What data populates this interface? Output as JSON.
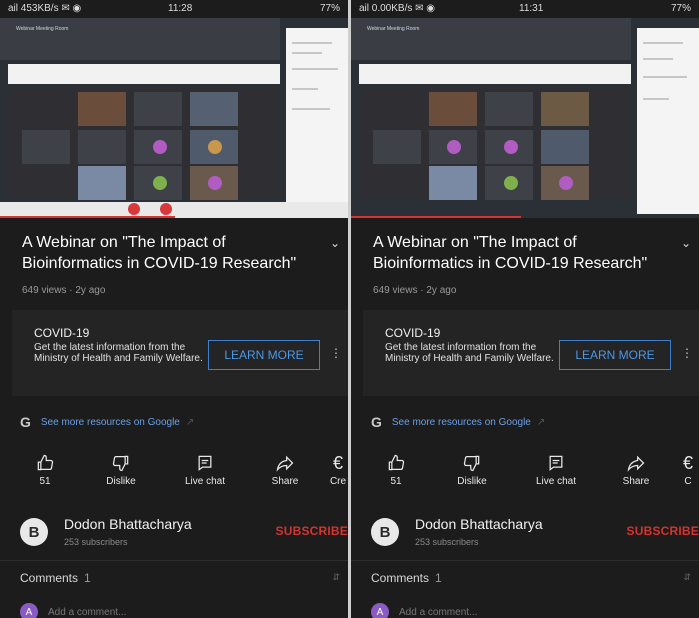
{
  "left": {
    "status": {
      "left": "ail 453KB/s ✉ ◉",
      "time": "11:28",
      "right": "77%"
    },
    "video_label": "Webinar Meeting Room",
    "title": "A Webinar on \"The Impact of Bioinformatics in COVID-19 Research\"",
    "meta": "649 views · 2y ago",
    "covid": {
      "title": "COVID-19",
      "description": "Get the latest information from the Ministry of Health and Family Welfare.",
      "button": "LEARN MORE"
    },
    "resources": {
      "icon": "G",
      "text": "See more resources on Google"
    },
    "actions": {
      "like": "51",
      "dislike": "Dislike",
      "live_chat": "Live chat",
      "share": "Share",
      "create": "Cre"
    },
    "channel": {
      "avatar_text": "B",
      "name": "Dodon Bhattacharya",
      "subscribers": "253 subscribers",
      "subscribe": "SUBSCRIBE"
    },
    "comments": {
      "label": "Comments",
      "count": "1",
      "avatar_letter": "A",
      "placeholder": "Add a comment..."
    }
  },
  "right": {
    "status": {
      "left": "ail 0.00KB/s ✉ ◉",
      "time": "11:31",
      "right": "77%"
    },
    "video_label": "Webinar Meeting Room",
    "title": "A Webinar on \"The Impact of Bioinformatics in COVID-19 Research\"",
    "meta": "649 views · 2y ago",
    "covid": {
      "title": "COVID-19",
      "description": "Get the latest information from the Ministry of Health and Family Welfare.",
      "button": "LEARN MORE"
    },
    "resources": {
      "icon": "G",
      "text": "See more resources on Google"
    },
    "actions": {
      "like": "51",
      "dislike": "Dislike",
      "live_chat": "Live chat",
      "share": "Share",
      "create": "C"
    },
    "channel": {
      "avatar_text": "B",
      "name": "Dodon Bhattacharya",
      "subscribers": "253 subscribers",
      "subscribe": "SUBSCRIBE"
    },
    "comments": {
      "label": "Comments",
      "count": "1",
      "avatar_letter": "A",
      "placeholder": "Add a comment..."
    }
  },
  "colors": {
    "accent_red": "#d6332e",
    "link_blue": "#4a98e8",
    "background": "#1c1c1c"
  }
}
